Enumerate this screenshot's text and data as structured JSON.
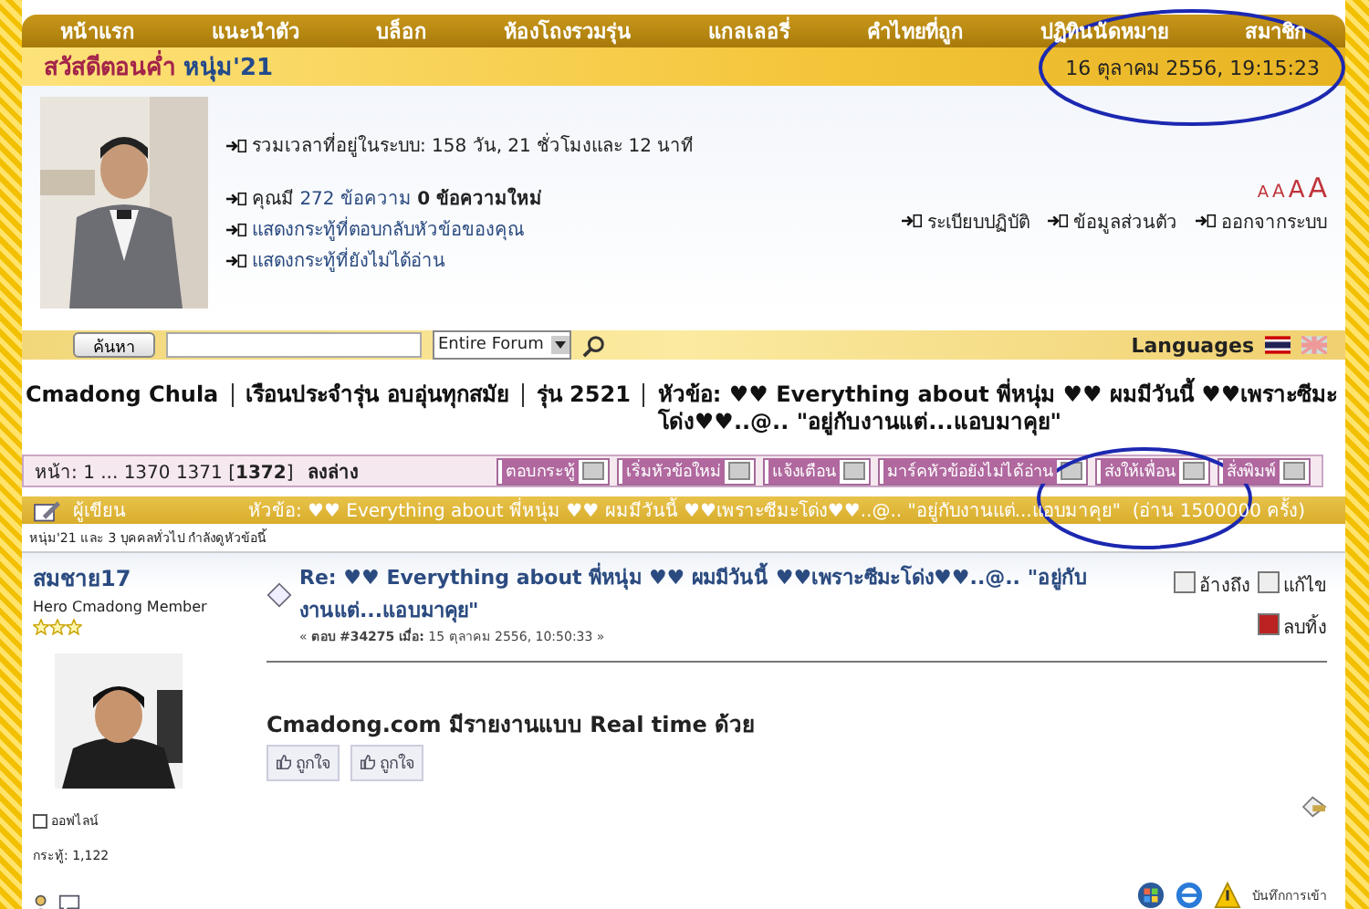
{
  "nav": {
    "items": [
      "หน้าแรก",
      "แนะนำตัว",
      "บล็อก",
      "ห้องโถงรวมรุ่น",
      "แกลเลอรี่",
      "คำไทยที่ถูก",
      "ปฏิทินนัดหมาย",
      "สมาชิก"
    ]
  },
  "greeting": {
    "prefix": "สวัสดีตอนค่ำ",
    "name": "หนุ่ม'21",
    "date": "16 ตุลาคม 2556, 19:15:23"
  },
  "user_panel": {
    "avatar": {
      "kind": "picture"
    },
    "online_time": "รวมเวลาที่อยู่ในระบบ: 158 วัน, 21 ชั่วโมงและ 12 นาที",
    "messages": {
      "prefix": "คุณมี",
      "count": "272 ข้อความ",
      "new": "0 ข้อความใหม่"
    },
    "links": [
      "แสดงกระทู้ที่ตอบกลับหัวข้อของคุณ",
      "แสดงกระทู้ที่ยังไม่ได้อ่าน"
    ],
    "font_sizes": [
      "A",
      "A",
      "A",
      "A"
    ],
    "right_links": [
      "ระเบียบปฏิบัติ",
      "ข้อมูลส่วนตัว",
      "ออกจากระบบ"
    ]
  },
  "search": {
    "button": "ค้นหา",
    "scope": "Entire Forum",
    "languages": "Languages"
  },
  "breadcrumb": {
    "items": [
      "Cmadong Chula",
      "เรือนประจำรุ่น อบอุ่นทุกสมัย",
      "รุ่น 2521"
    ],
    "topic": "หัวข้อ: ♥♥ Everything about พี่หนุ่ม ♥♥ ผมมีวันนี้ ♥♥เพราะซีมะโด่ง♥♥..@.. \"อยู่กับงานแต่...แอบมาคุย\""
  },
  "pagination": {
    "label": "หน้า:",
    "pages": "1 ... 1370 1371 [**1372**]",
    "bottom_link": "ลงล่าง"
  },
  "toolbar": [
    "ตอบกระทู้",
    "เริ่มหัวข้อใหม่",
    "แจ้งเตือน",
    "มาร์คหัวข้อยังไม่ได้อ่าน",
    "ส่งให้เพื่อน",
    "สั่งพิมพ์"
  ],
  "topic_header": {
    "author_label": "ผู้เขียน",
    "title": "หัวข้อ: ♥♥ Everything about พี่หนุ่ม ♥♥ ผมมีวันนี้ ♥♥เพราะซีมะโด่ง♥♥..@.. \"อยู่กับงานแต่...แอบมาคุย\"",
    "views": "(อ่าน 1500000 ครั้ง)"
  },
  "viewers": "หนุ่ม'21 และ 3 บุคคลทั่วไป กำลังดูหัวข้อนี้",
  "post": {
    "author": "สมชาย17",
    "rank": "Hero Cmadong Member",
    "stars": 3,
    "avatar": {
      "kind": "picture"
    },
    "online": false,
    "status": "ออฟไลน์",
    "post_count": "กระทู้: 1,122",
    "title": "Re: ♥♥ Everything about พี่หนุ่ม ♥♥ ผมมีวันนี้ ♥♥เพราะซีมะโด่ง♥♥..@.. \"อยู่กับงานแต่...แอบมาคุย\"",
    "meta": "« **ตอบ #34275 เมื่อ:** 15 ตุลาคม 2556, 10:50:33 »",
    "body": "Cmadong.com มีรายงานแบบ Real time ด้วย",
    "likes": [
      "ถูกใจ",
      "ถูกใจ"
    ],
    "actions": [
      "อ้างถึง",
      "แก้ไข",
      "ลบทิ้ง"
    ],
    "footer": "บันทึกการเข้า"
  }
}
